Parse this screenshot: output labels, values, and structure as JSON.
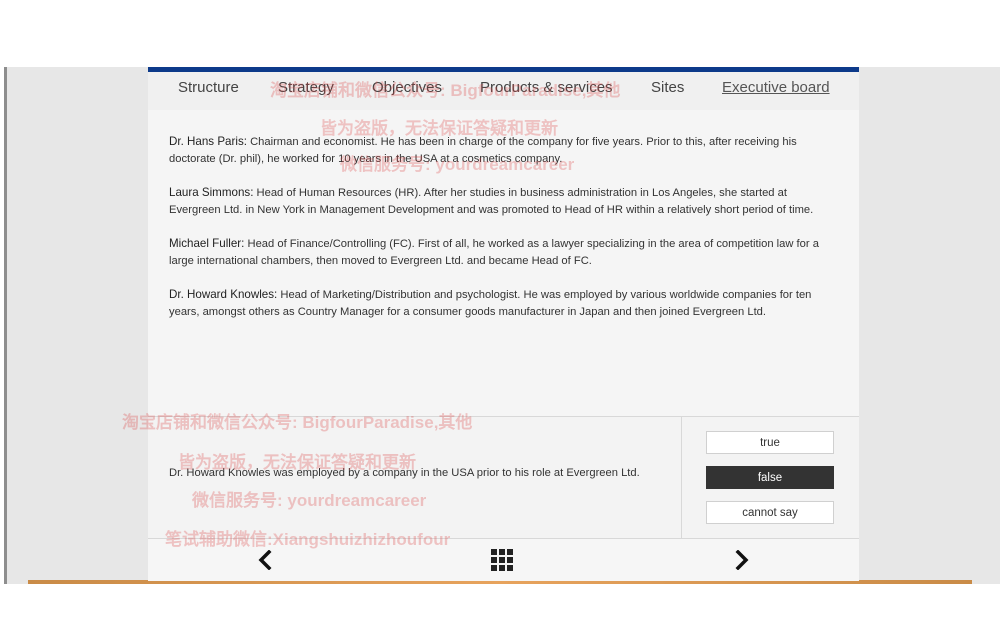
{
  "tabs": [
    {
      "label": "Structure",
      "active": false
    },
    {
      "label": "Strategy",
      "active": false
    },
    {
      "label": "Objectives",
      "active": false
    },
    {
      "label": "Products & services",
      "active": false
    },
    {
      "label": "Sites",
      "active": false
    },
    {
      "label": "Executive board",
      "active": true
    }
  ],
  "board": [
    {
      "name": "Dr. Hans Paris:",
      "text": " Chairman and economist. He has been in charge of the company for five years. Prior to this, after receiving his doctorate (Dr. phil), he worked for 10 years in the USA at a cosmetics company."
    },
    {
      "name": "Laura Simmons:",
      "text": " Head of Human Resources (HR). After her studies in business administration in Los Angeles, she started at Evergreen Ltd. in New York in Management Development and was promoted to Head of HR within a relatively short period of time."
    },
    {
      "name": "Michael Fuller:",
      "text": " Head of Finance/Controlling (FC). First of all, he worked as a lawyer specializing in the area of competition law for a large international chambers, then moved to Evergreen Ltd. and became Head of FC."
    },
    {
      "name": "Dr. Howard Knowles:",
      "text": " Head of Marketing/Distribution and psychologist. He was employed by various worldwide companies for ten years, amongst others as Country Manager for a consumer goods manufacturer in Japan and then joined Evergreen Ltd."
    }
  ],
  "question": {
    "statement": "Dr. Howard Knowles was employed by a company in the USA prior to his role at Evergreen Ltd.",
    "options": [
      {
        "label": "true",
        "selected": false
      },
      {
        "label": "false",
        "selected": true
      },
      {
        "label": "cannot say",
        "selected": false
      }
    ]
  },
  "nav": {
    "prev_icon": "chevron-left-icon",
    "menu_icon": "grid-icon",
    "next_icon": "chevron-right-icon"
  },
  "watermarks": [
    "淘宝店铺和微信公众号: BigfourParadise,其他",
    "皆为盗版，无法保证答疑和更新",
    "微信服务号: yourdreamcareer",
    "淘宝店铺和微信公众号: BigfourParadise,其他",
    "皆为盗版，无法保证答疑和更新",
    "微信服务号: yourdreamcareer",
    "笔试辅助微信:Xiangshuizhizhoufour"
  ],
  "colors": {
    "accent_top": "#0d3a8a",
    "selected_button": "#333333",
    "bottom_bar": "#e7a35d"
  }
}
